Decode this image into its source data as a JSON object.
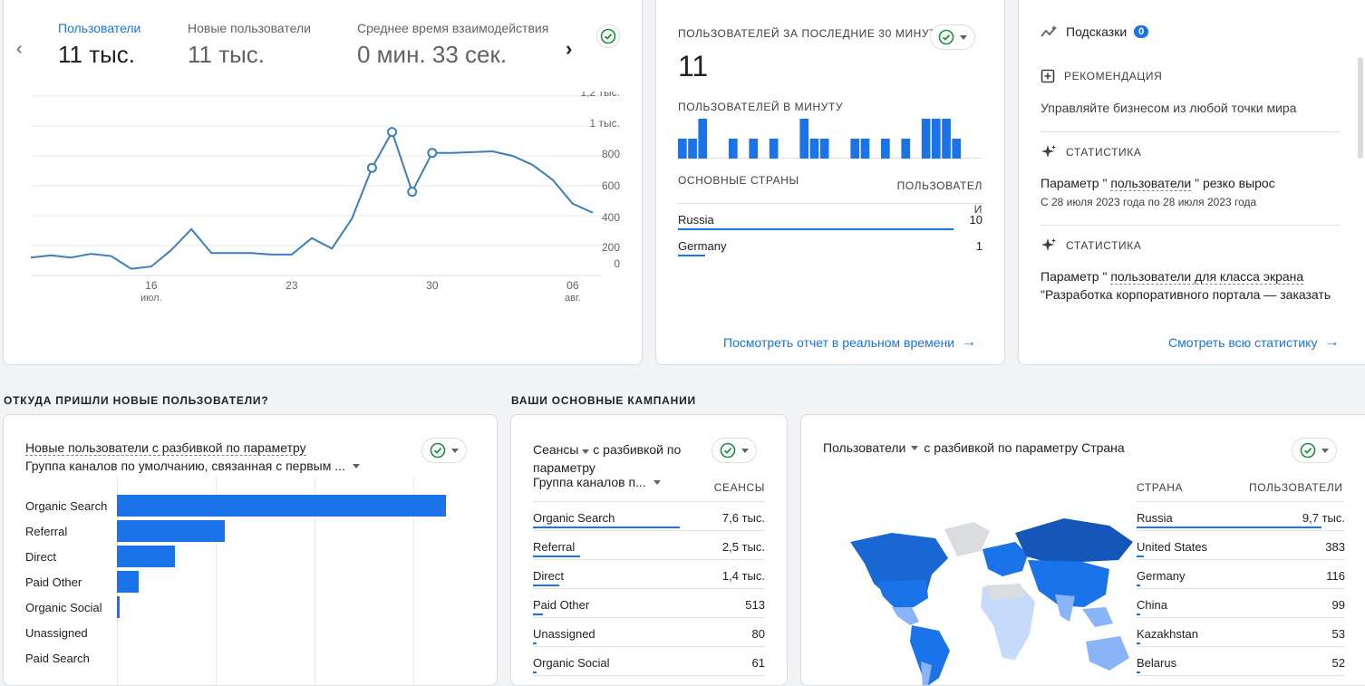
{
  "overview": {
    "metrics": [
      {
        "label": "Пользователи",
        "value": "11 тыс."
      },
      {
        "label": "Новые пользователи",
        "value": "11 тыс."
      },
      {
        "label": "Среднее время взаимодействия",
        "value": "0 мин. 33 сек."
      }
    ],
    "chart": {
      "y_ticks": [
        "1,2 тыс.",
        "1 тыс.",
        "800",
        "600",
        "400",
        "200",
        "0"
      ],
      "x_ticks": [
        {
          "label": "16",
          "sub": "июл."
        },
        {
          "label": "23",
          "sub": ""
        },
        {
          "label": "30",
          "sub": ""
        },
        {
          "label": "06",
          "sub": "авг."
        }
      ]
    }
  },
  "chart_data": {
    "type": "line",
    "x": [
      "10.07",
      "11.07",
      "12.07",
      "13.07",
      "14.07",
      "15.07",
      "16.07",
      "17.07",
      "18.07",
      "19.07",
      "20.07",
      "21.07",
      "22.07",
      "23.07",
      "24.07",
      "25.07",
      "26.07",
      "27.07",
      "28.07",
      "29.07",
      "30.07",
      "31.07",
      "01.08",
      "02.08",
      "03.08",
      "04.08",
      "05.08",
      "06.08",
      "07.08"
    ],
    "series": [
      {
        "values": [
          120,
          135,
          120,
          145,
          130,
          45,
          60,
          170,
          310,
          150,
          150,
          150,
          140,
          140,
          250,
          180,
          380,
          720,
          960,
          560,
          820,
          820,
          825,
          830,
          800,
          740,
          640,
          480,
          420
        ]
      }
    ],
    "ylim": [
      0,
      1200
    ],
    "grid": true
  },
  "realtime": {
    "title": "ПОЛЬЗОВАТЕЛЕЙ ЗА ПОСЛЕДНИЕ 30 МИНУТ",
    "value": "11",
    "per_minute_label": "ПОЛЬЗОВАТЕЛЕЙ В МИНУТУ",
    "per_minute": [
      1,
      1,
      2,
      0,
      0,
      1,
      0,
      1,
      0,
      1,
      0,
      0,
      2,
      1,
      1,
      0,
      0,
      1,
      1,
      0,
      1,
      0,
      1,
      0,
      2,
      2,
      2,
      1,
      0,
      0
    ],
    "countries_header": "ОСНОВНЫЕ СТРАНЫ",
    "users_header_1": "ПОЛЬЗОВАТЕЛ",
    "users_header_2": "И",
    "rows": [
      {
        "name": "Russia",
        "value": "10",
        "fraction": 0.9
      },
      {
        "name": "Germany",
        "value": "1",
        "fraction": 0.09
      }
    ],
    "link": "Посмотреть отчет в реальном времени"
  },
  "insights": {
    "title": "Подсказки",
    "badge": "0",
    "items": [
      {
        "type": "РЕКОМЕНДАЦИЯ",
        "text": "Управляйте бизнесом из любой точки мира",
        "sub": ""
      },
      {
        "type": "СТАТИСТИКА",
        "text_a": "Параметр \" ",
        "text_b": "пользователи",
        "text_c": " \" резко вырос",
        "sub": "С 28 июля 2023 года по 28 июля 2023 года"
      },
      {
        "type": "СТАТИСТИКА",
        "text_a": "Параметр \" ",
        "text_b": "пользователи для класса экрана",
        "line2": "\"Разработка корпоративного портала — заказать"
      }
    ],
    "link": "Смотреть всю статистику"
  },
  "sections": {
    "acquisition": "ОТКУДА ПРИШЛИ НОВЫЕ ПОЛЬЗОВАТЕЛИ?",
    "campaigns": "ВАШИ ОСНОВНЫЕ КАМПАНИИ"
  },
  "acq_card": {
    "title_line1": "Новые пользователи с разбивкой по параметру",
    "title_line2": "Группа каналов по умолчанию, связанная с первым ...",
    "bars": [
      {
        "label": "Organic Search",
        "value": 7600
      },
      {
        "label": "Referral",
        "value": 2500
      },
      {
        "label": "Direct",
        "value": 1340
      },
      {
        "label": "Paid Other",
        "value": 500
      },
      {
        "label": "Organic Social",
        "value": 60
      },
      {
        "label": "Unassigned",
        "value": 0
      },
      {
        "label": "Paid Search",
        "value": 0
      }
    ]
  },
  "campaigns_card": {
    "title_a": "Сеансы",
    "title_b": "с разбивкой по",
    "title_c": "параметру",
    "title_d": "Группа каналов п...",
    "col_header": "СЕАНСЫ",
    "rows": [
      {
        "name": "Organic Search",
        "value": "7,6 тыс.",
        "fraction": 1.0
      },
      {
        "name": "Referral",
        "value": "2,5 тыс.",
        "fraction": 0.32
      },
      {
        "name": "Direct",
        "value": "1,4 тыс.",
        "fraction": 0.18
      },
      {
        "name": "Paid Other",
        "value": "513",
        "fraction": 0.07
      },
      {
        "name": "Unassigned",
        "value": "80",
        "fraction": 0.02
      },
      {
        "name": "Organic Social",
        "value": "61",
        "fraction": 0.01
      }
    ]
  },
  "country_card": {
    "title_a": "Пользователи",
    "title_b": "с разбивкой по параметру Страна",
    "col1": "СТРАНА",
    "col2": "ПОЛЬЗОВАТЕЛИ",
    "rows": [
      {
        "name": "Russia",
        "value": "9,7 тыс.",
        "fraction": 1.0
      },
      {
        "name": "United States",
        "value": "383",
        "fraction": 0.04
      },
      {
        "name": "Germany",
        "value": "116",
        "fraction": 0.012
      },
      {
        "name": "China",
        "value": "99",
        "fraction": 0.01
      },
      {
        "name": "Kazakhstan",
        "value": "53",
        "fraction": 0.006
      },
      {
        "name": "Belarus",
        "value": "52",
        "fraction": 0.005
      }
    ]
  },
  "colors": {
    "blue": "#1a73e8",
    "dark_blue": "#1967d2",
    "green": "#1e8e3e",
    "line": "#4285f4"
  }
}
